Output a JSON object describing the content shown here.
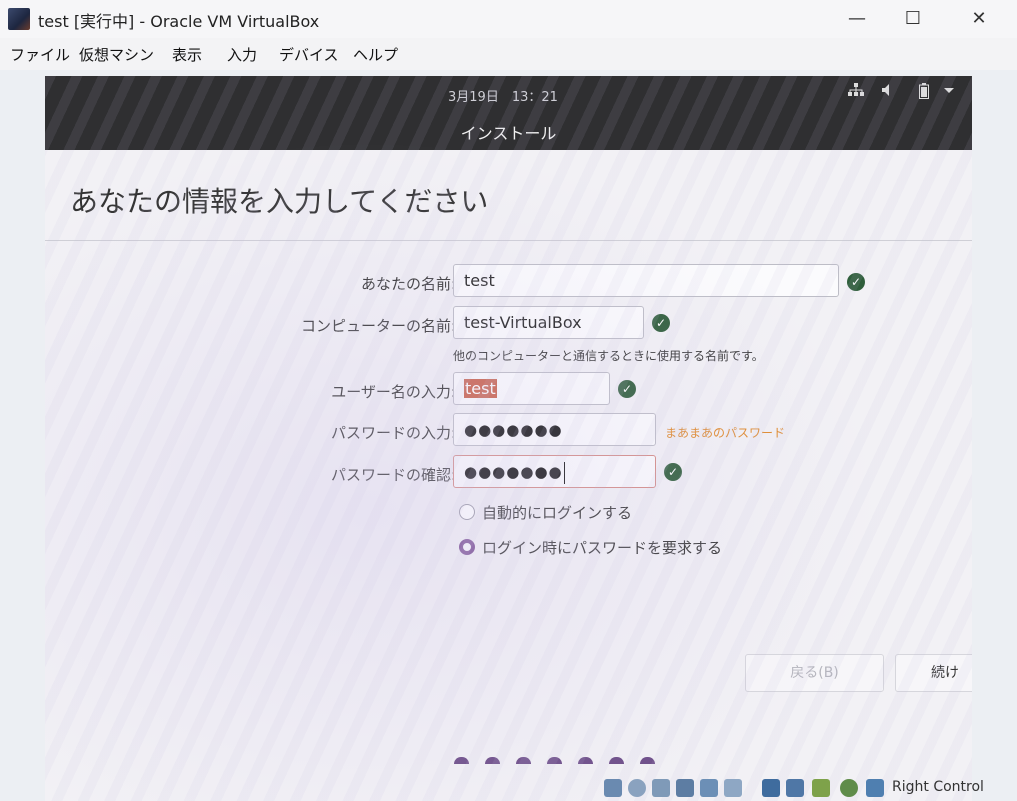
{
  "window": {
    "title": "test [実行中] - Oracle VM VirtualBox",
    "minimize": "—",
    "maximize": "☐",
    "close": "✕"
  },
  "menu": [
    "ファイル",
    "仮想マシン",
    "表示",
    "入力",
    "デバイス",
    "ヘルプ"
  ],
  "topbar": {
    "clock": "3月19日　13：21",
    "network_icon": "network-icon",
    "volume_icon": "volume-icon",
    "battery_icon": "battery-icon",
    "menu_icon": "dropdown-arrow-icon",
    "title": "インストール"
  },
  "page": {
    "heading": "あなたの情報を入力してください"
  },
  "form": {
    "name_label": "あなたの名前:",
    "name_value": "test",
    "computer_label": "コンピューターの名前:",
    "computer_value": "test-VirtualBox",
    "computer_hint": "他のコンピューターと通信するときに使用する名前です。",
    "username_label": "ユーザー名の入力:",
    "username_value": "test",
    "password_label": "パスワードの入力:",
    "password_value": "●●●●●●●",
    "password_strength": "まあまあのパスワード",
    "confirm_label": "パスワードの確認:",
    "confirm_value": "●●●●●●●",
    "check_mark": "✓"
  },
  "login_options": {
    "auto_login": "自動的にログインする",
    "require_password": "ログイン時にパスワードを要求する",
    "selected": "require_password"
  },
  "buttons": {
    "back": "戻る(B)",
    "continue": "続け"
  },
  "progress": {
    "total_steps": 7
  },
  "statusbar": {
    "host_key": "Right Control"
  },
  "colors": {
    "accent": "#7b4f93",
    "check": "#2f5e3b",
    "strength": "#e08a2c",
    "topbar": "#2f2f31"
  }
}
